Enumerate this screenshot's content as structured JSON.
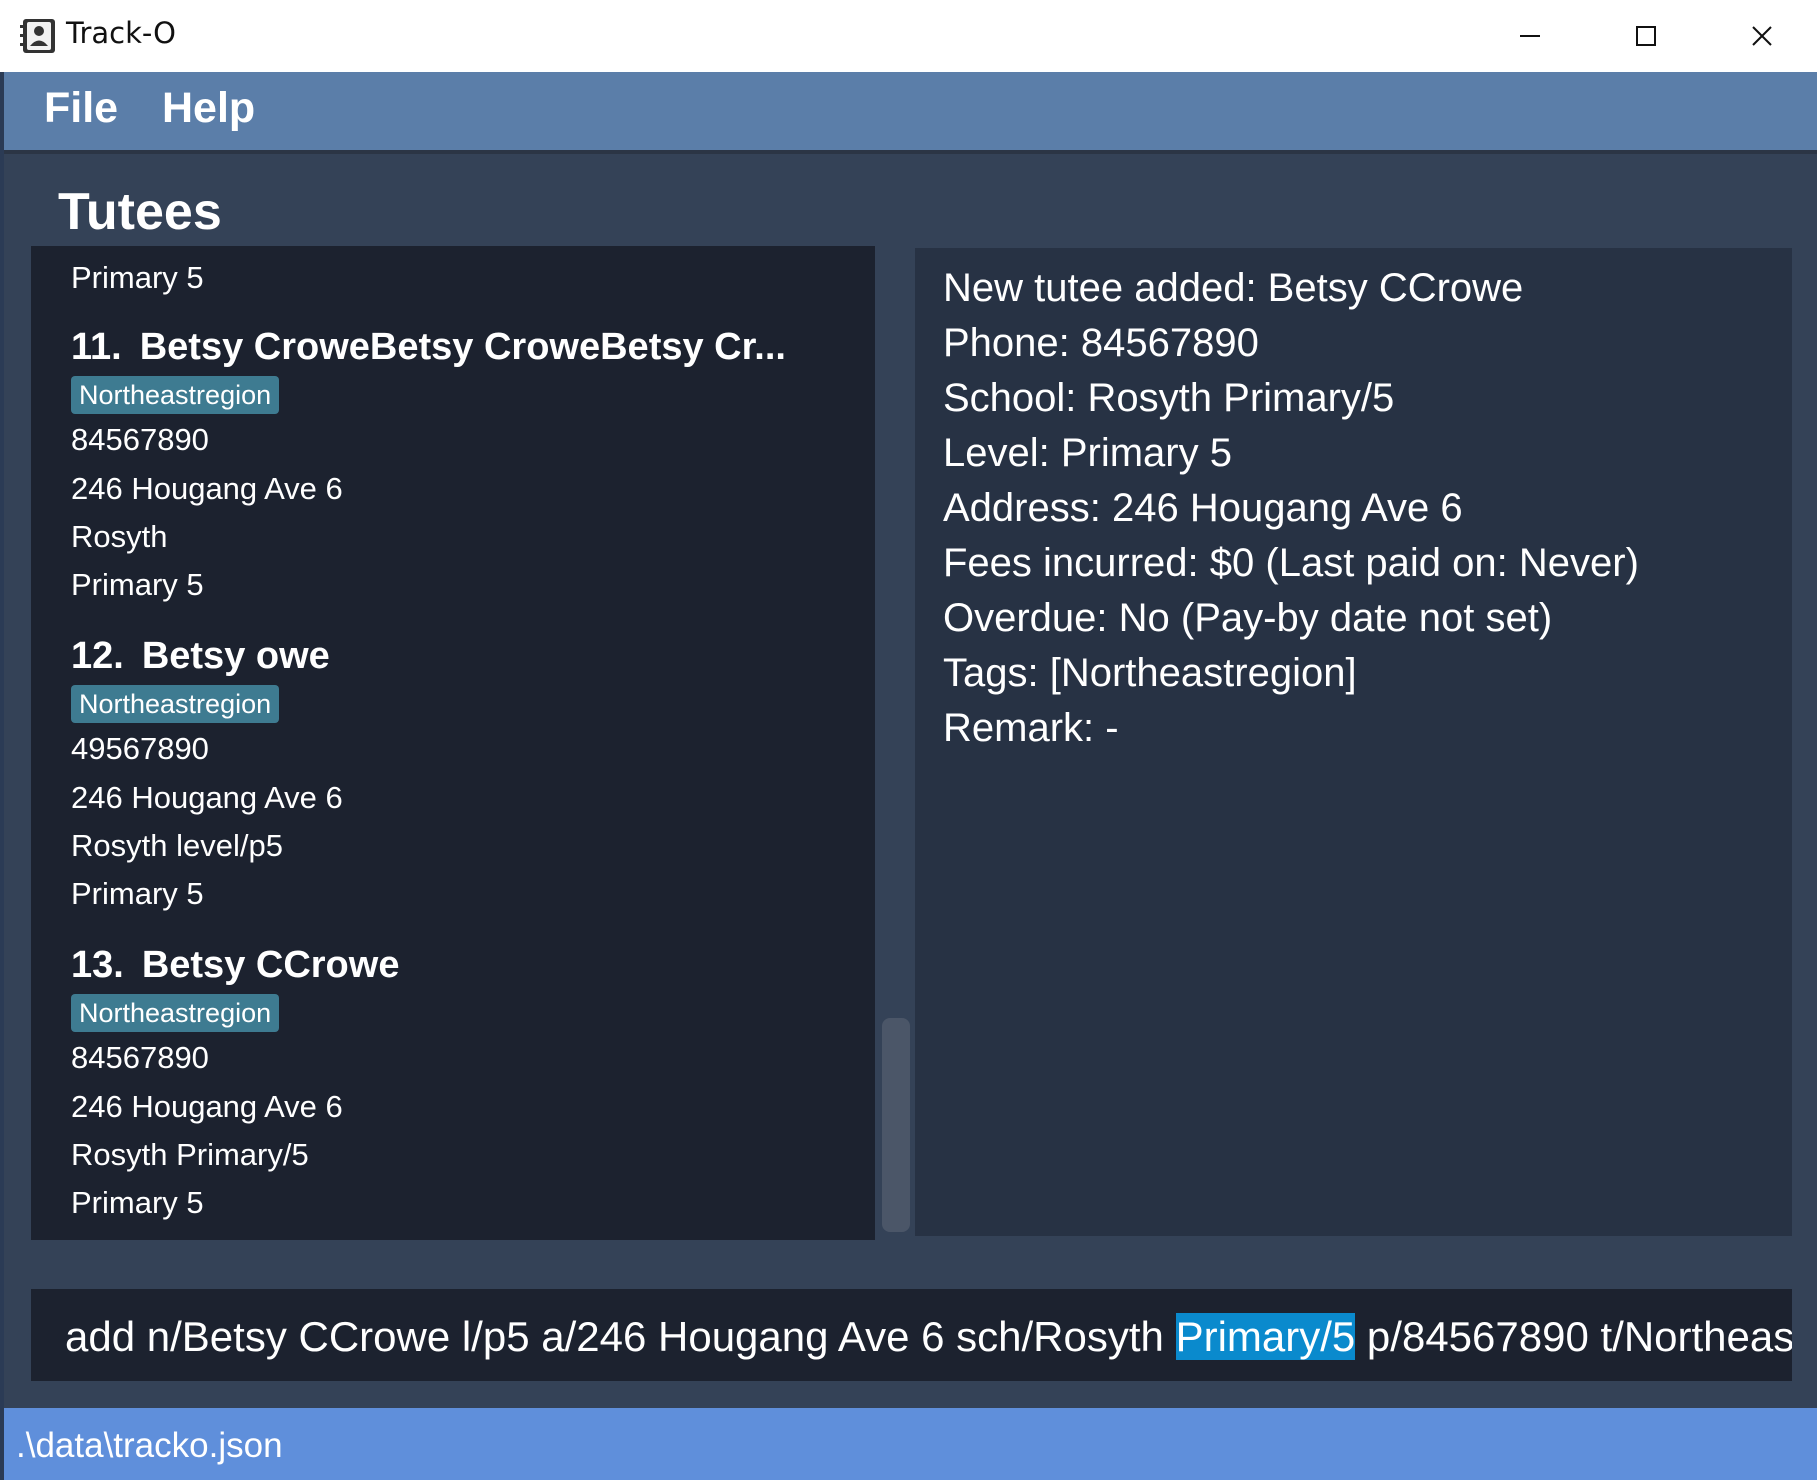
{
  "window": {
    "title": "Track-O",
    "icon": "address-book-icon",
    "controls": [
      "minimize-icon",
      "maximize-icon",
      "close-icon"
    ]
  },
  "menu": {
    "file": "File",
    "help": "Help"
  },
  "list": {
    "title": "Tutees",
    "partial_top_line": "Primary 5",
    "cards": [
      {
        "index": "11.",
        "name": "Betsy CroweBetsy CroweBetsy Cr...",
        "tag": "Northeastregion",
        "phone": "84567890",
        "address": "246 Hougang Ave 6",
        "school": "Rosyth",
        "level": "Primary 5"
      },
      {
        "index": "12.",
        "name": "Betsy owe",
        "tag": "Northeastregion",
        "phone": "49567890",
        "address": "246 Hougang Ave 6",
        "school": "Rosyth level/p5",
        "level": "Primary 5"
      },
      {
        "index": "13.",
        "name": "Betsy CCrowe",
        "tag": "Northeastregion",
        "phone": "84567890",
        "address": "246 Hougang Ave 6",
        "school": "Rosyth Primary/5",
        "level": "Primary 5"
      }
    ]
  },
  "result": {
    "lines": [
      "New tutee added: Betsy CCrowe",
      "Phone: 84567890",
      "School: Rosyth Primary/5",
      "Level: Primary 5",
      "Address: 246 Hougang Ave 6",
      "Fees incurred: $0 (Last paid on: Never)",
      "Overdue: No (Pay-by date not set)",
      "Tags: [Northeastregion]",
      "Remark: -"
    ]
  },
  "command": {
    "before_selection": "add n/Betsy CCrowe l/p5 a/246 Hougang Ave 6 sch/Rosyth ",
    "selection": "Primary/5",
    "after_selection": " p/84567890 t/Northeas"
  },
  "status": {
    "path": ".\\data\\tracko.json"
  },
  "colors": {
    "menubar": "#5b7ea9",
    "background": "#344257",
    "list_panel": "#1c222f",
    "result_panel": "#273244",
    "tag": "#3e7b91",
    "selection": "#0a8acd",
    "statusbar": "#5f8fdb"
  }
}
